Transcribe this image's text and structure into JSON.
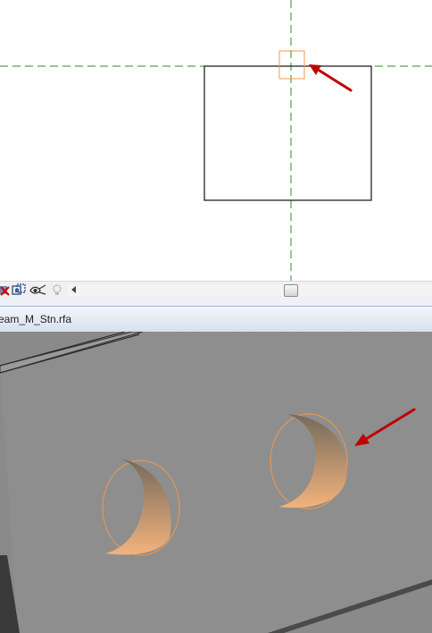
{
  "colors": {
    "dashed_reference_line": "#2e8b2e",
    "selection_highlight": "#f39a4a",
    "annotation_arrow": "#c00000",
    "model_face": "#8e8e8e",
    "background_3d": "#8a8a8a",
    "cut_gradient_top": "#74695b",
    "cut_gradient_bottom": "#f3b37c"
  },
  "view_control_bar": {
    "icons": [
      "remove-hidden-icon",
      "temporary-hide-icon",
      "reveal-hidden-icon",
      "analysis-display-icon"
    ]
  },
  "document_tab": {
    "title": "eam_M_Stn.rfa"
  }
}
